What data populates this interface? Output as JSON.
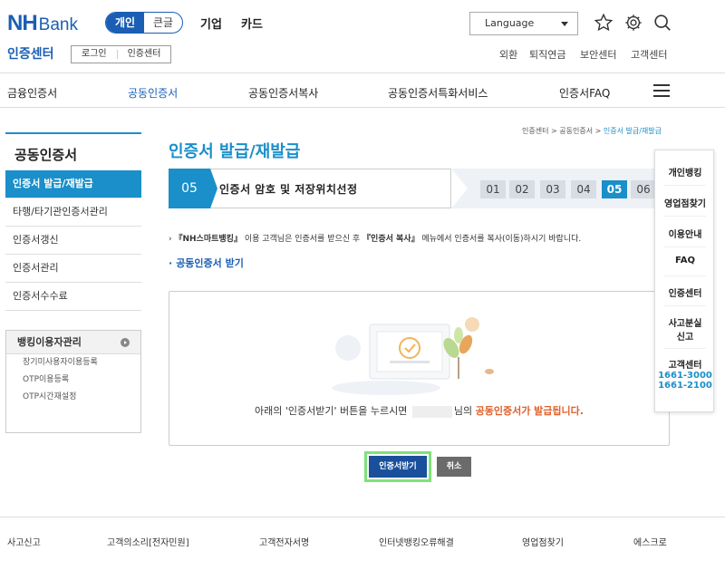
{
  "header": {
    "logo_nh": "NH",
    "logo_bank": "Bank",
    "segment": [
      "개인",
      "큰글"
    ],
    "nav": [
      "기업",
      "카드"
    ],
    "language": "Language",
    "site_name": "인증센터",
    "sub_buttons": [
      "로그인",
      "인증센터"
    ],
    "utils": [
      "외환",
      "퇴직연금",
      "보안센터",
      "고객센터"
    ]
  },
  "main_nav": [
    "금융인증서",
    "공동인증서",
    "공동인증서복사",
    "공동인증서특화서비스",
    "인증서FAQ"
  ],
  "sidebar": {
    "title": "공동인증서",
    "items": [
      "인증서 발급/재발급",
      "타행/타기관인증서관리",
      "인증서갱신",
      "인증서관리",
      "인증서수수료"
    ],
    "box_title": "뱅킹이용자관리",
    "box_items": [
      "장기미사용자이용등록",
      "OTP이용등록",
      "OTP시간재설정"
    ]
  },
  "content": {
    "breadcrumb": [
      "인증센터",
      "공동인증서",
      "인증서 발급/재발급"
    ],
    "breadcrumb_sep": " > ",
    "title": "인증서 발급/재발급",
    "step": {
      "num": "05",
      "label": "인증서 암호 및 저장위치선정",
      "chips": [
        "01",
        "02",
        "03",
        "04",
        "05",
        "06"
      ]
    },
    "notice_prefix": "『NH스마트뱅킹』",
    "notice_mid": " 이용 고객님은 인증서를 받으신 후 ",
    "notice_menu": "『인증서 복사』",
    "notice_suffix": " 메뉴에서 인증서를 복사(이동)하시기 바랍니다.",
    "sub_link": "공동인증서 받기",
    "panel_text_a": "아래의 '인증서받기' 버튼을 누르시면",
    "panel_text_b": "님의",
    "panel_text_hl": "공동인증서가 발급됩니다.",
    "btn_issue": "인증서받기",
    "btn_cancel": "취소"
  },
  "float_menu": {
    "items": [
      "개인뱅킹",
      "영업점찾기",
      "이용안내",
      "FAQ",
      "인증센터"
    ],
    "loss_a": "사고분실",
    "loss_b": "신고",
    "cs": "고객센터",
    "tel1": "1661-3000",
    "tel2": "1661-2100"
  },
  "footer": [
    "사고신고",
    "고객의소리[전자민원]",
    "고객전자서명",
    "인터넷뱅킹오류해결",
    "영업점찾기",
    "에스크로"
  ],
  "colors": {
    "brand": "#1a5fb4",
    "accent": "#1a8fc9",
    "highlight": "#e0602b",
    "focus": "#7fe27a"
  }
}
